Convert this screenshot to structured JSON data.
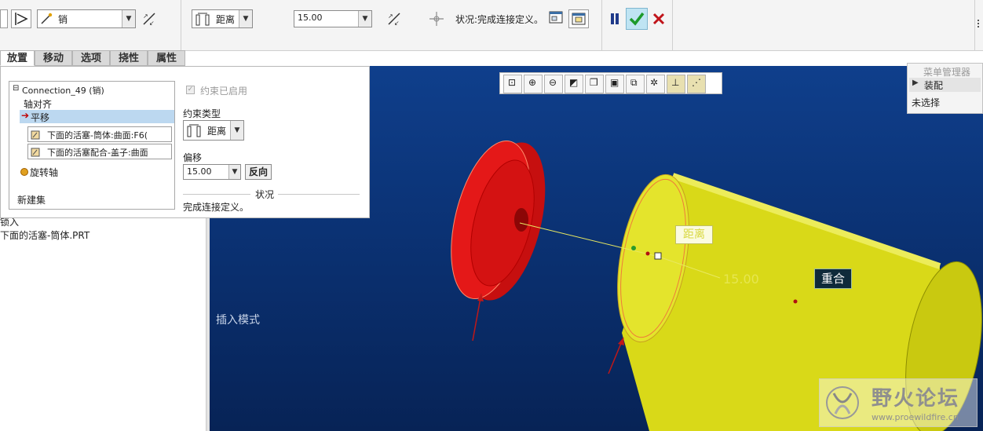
{
  "toolbar": {
    "constraint_combo": "销",
    "type_combo": "距离",
    "offset_value": "15.00",
    "status_text": "状况:完成连接定义。"
  },
  "tabs": [
    "放置",
    "移动",
    "选项",
    "挠性",
    "属性"
  ],
  "panel": {
    "tree": {
      "connection": "Connection_49 (销)",
      "axis_align": "轴对齐",
      "translate": "平移",
      "ref1": "下面的活塞-筒体:曲面:F6(",
      "ref2": "下面的活塞配合-盖子:曲面",
      "rotation_axis": "旋转轴",
      "new_set": "新建集"
    },
    "constraint_enabled": "约束已启用",
    "constraint_type_label": "约束类型",
    "constraint_type_value": "距离",
    "offset_label": "偏移",
    "offset_value": "15.00",
    "flip_button": "反向",
    "status_header": "状况",
    "status_message": "完成连接定义。"
  },
  "left_pane": {
    "line_partial": "锁入",
    "part_file": "下面的活塞-筒体.PRT"
  },
  "viewport": {
    "insert_mode": "插入模式",
    "distance_label": "距离",
    "dimension_value": "15.00",
    "coincident_label": "重合"
  },
  "menu_manager": {
    "title": "菜单管理器",
    "item_assembly": "装配",
    "item_unselected": "未选择"
  },
  "watermark": {
    "site_name": "野火论坛",
    "url": "www.proewildfire.cn"
  }
}
